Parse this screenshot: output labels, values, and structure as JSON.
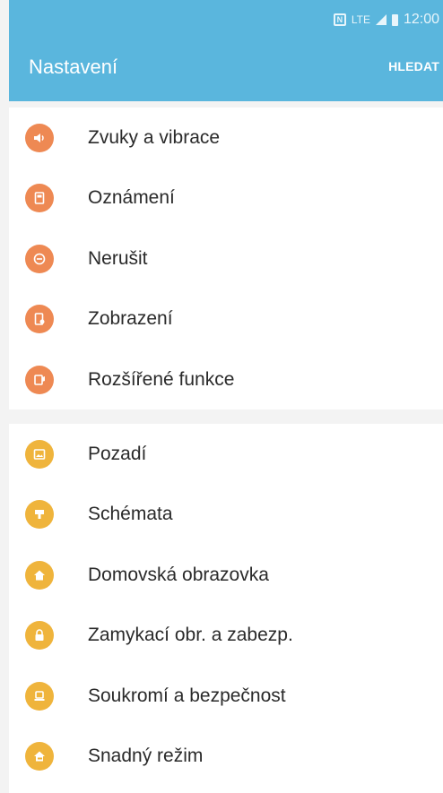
{
  "status": {
    "time": "12:00",
    "network": "LTE"
  },
  "header": {
    "title": "Nastavení",
    "search_label": "HLEDAT",
    "color": "#5ab6dd"
  },
  "groups": [
    {
      "color": "#ee8953",
      "items": [
        {
          "label": "Zvuky a vibrace",
          "icon": "speaker-icon"
        },
        {
          "label": "Oznámení",
          "icon": "notification-icon"
        },
        {
          "label": "Nerušit",
          "icon": "do-not-disturb-icon"
        },
        {
          "label": "Zobrazení",
          "icon": "display-icon"
        },
        {
          "label": "Rozšířené funkce",
          "icon": "advanced-features-icon"
        }
      ]
    },
    {
      "color": "#efb43c",
      "items": [
        {
          "label": "Pozadí",
          "icon": "wallpaper-icon"
        },
        {
          "label": "Schémata",
          "icon": "themes-icon"
        },
        {
          "label": "Domovská obrazovka",
          "icon": "home-icon"
        },
        {
          "label": "Zamykací obr. a zabezp.",
          "icon": "lock-icon"
        },
        {
          "label": "Soukromí a bezpečnost",
          "icon": "privacy-icon"
        },
        {
          "label": "Snadný režim",
          "icon": "easy-mode-icon"
        }
      ]
    }
  ]
}
